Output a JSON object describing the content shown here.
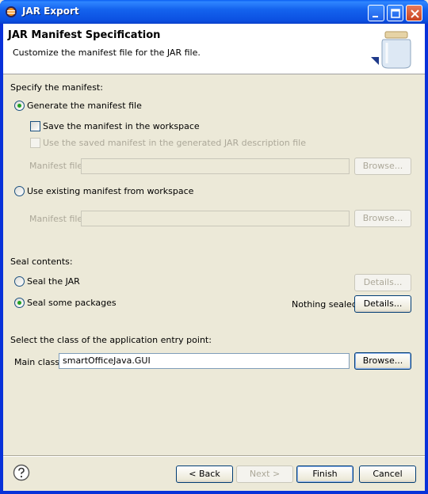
{
  "window": {
    "title": "JAR Export",
    "icon": "eclipse-icon",
    "controls": [
      "minimize-icon",
      "maximize-icon",
      "close-icon"
    ]
  },
  "banner": {
    "title": "JAR Manifest Specification",
    "description": "Customize the manifest file for the JAR file.",
    "graphic": "jar-icon"
  },
  "manifest": {
    "section_label": "Specify the manifest:",
    "generate_label": "Generate the manifest file",
    "generate_selected": true,
    "save_label": "Save the manifest in the workspace",
    "save_checked": false,
    "reuse_label": "Use the saved manifest in the generated JAR description file",
    "reuse_checked": false,
    "manifest_file_label_1": "Manifest file:",
    "manifest_file_value_1": "",
    "browse_label_1": "Browse...",
    "existing_label": "Use existing manifest from workspace",
    "existing_selected": false,
    "manifest_file_label_2": "Manifest file:",
    "manifest_file_value_2": "",
    "browse_label_2": "Browse..."
  },
  "seal": {
    "section_label": "Seal contents:",
    "seal_jar_label": "Seal the JAR",
    "seal_jar_selected": false,
    "details_label_1": "Details...",
    "seal_some_label": "Seal some packages",
    "seal_some_selected": true,
    "status": "Nothing sealed",
    "details_label_2": "Details..."
  },
  "entry": {
    "section_label": "Select the class of the application entry point:",
    "main_class_label": "Main class:",
    "main_class_value": "smartOfficeJava.GUI",
    "browse_label": "Browse..."
  },
  "footer": {
    "help_icon": "help-icon",
    "back_label": "< Back",
    "next_label": "Next >",
    "finish_label": "Finish",
    "cancel_label": "Cancel"
  }
}
